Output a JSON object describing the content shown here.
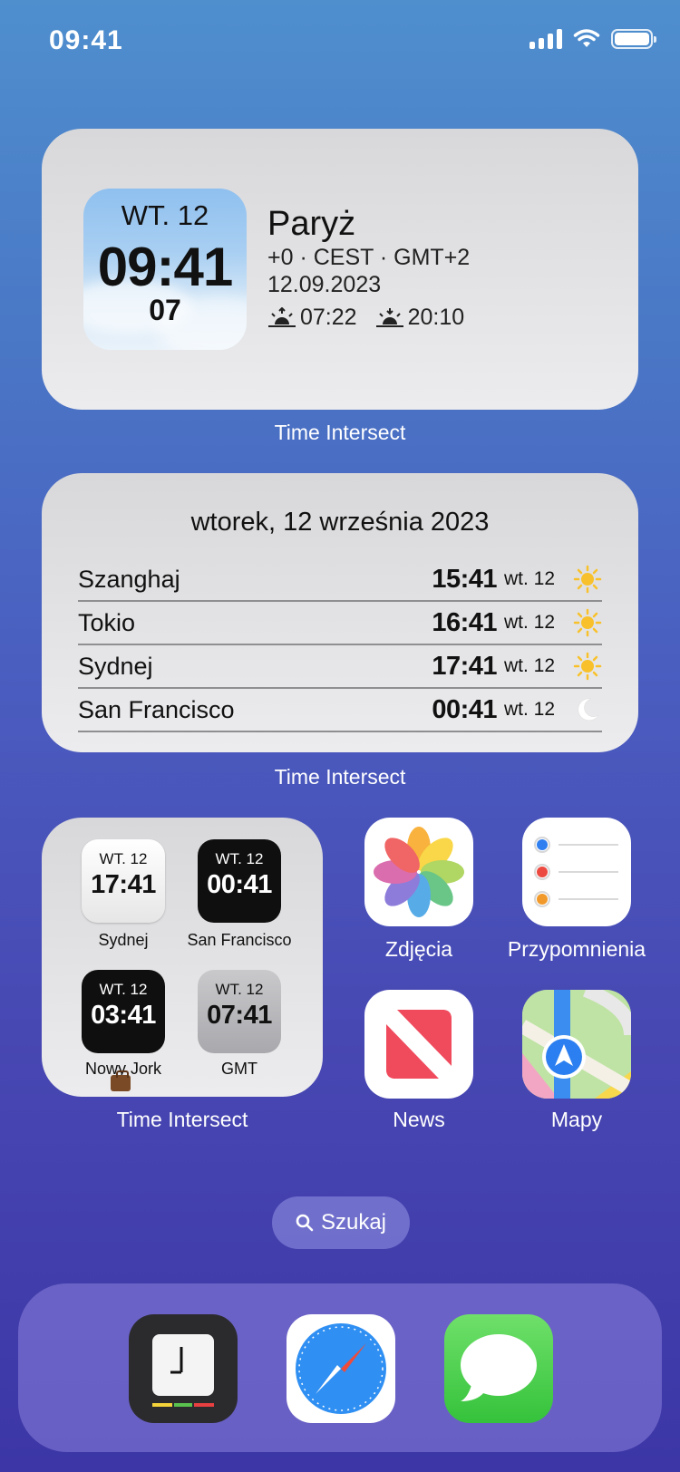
{
  "status_bar": {
    "time": "09:41"
  },
  "widget_paris": {
    "day": "WT. 12",
    "time": "09:41",
    "seconds": "07",
    "city": "Paryż",
    "timezone": "+0 · CEST · GMT+2",
    "date": "12.09.2023",
    "sunrise": "07:22",
    "sunset": "20:10",
    "caption": "Time Intersect"
  },
  "widget_list": {
    "title": "wtorek, 12 września 2023",
    "rows": [
      {
        "city": "Szanghaj",
        "time": "15:41",
        "day": "wt. 12",
        "icon": "sun-icon"
      },
      {
        "city": "Tokio",
        "time": "16:41",
        "day": "wt. 12",
        "icon": "sun-icon"
      },
      {
        "city": "Sydnej",
        "time": "17:41",
        "day": "wt. 12",
        "icon": "sun-icon"
      },
      {
        "city": "San Francisco",
        "time": "00:41",
        "day": "wt. 12",
        "icon": "moon-icon"
      }
    ],
    "caption": "Time Intersect"
  },
  "widget_grid": {
    "tiles": [
      {
        "day": "WT. 12",
        "time": "17:41",
        "label": "Sydnej"
      },
      {
        "day": "WT. 12",
        "time": "00:41",
        "label": "San Francisco"
      },
      {
        "day": "WT. 12",
        "time": "03:41",
        "label": "Nowy Jork"
      },
      {
        "day": "WT. 12",
        "time": "07:41",
        "label": "GMT"
      }
    ],
    "caption": "Time Intersect"
  },
  "apps": {
    "photos": "Zdjęcia",
    "reminders": "Przypomnienia",
    "news": "News",
    "maps": "Mapy"
  },
  "search": {
    "label": "Szukaj"
  },
  "dock": [
    "clock-app-icon",
    "safari-icon",
    "messages-icon"
  ]
}
